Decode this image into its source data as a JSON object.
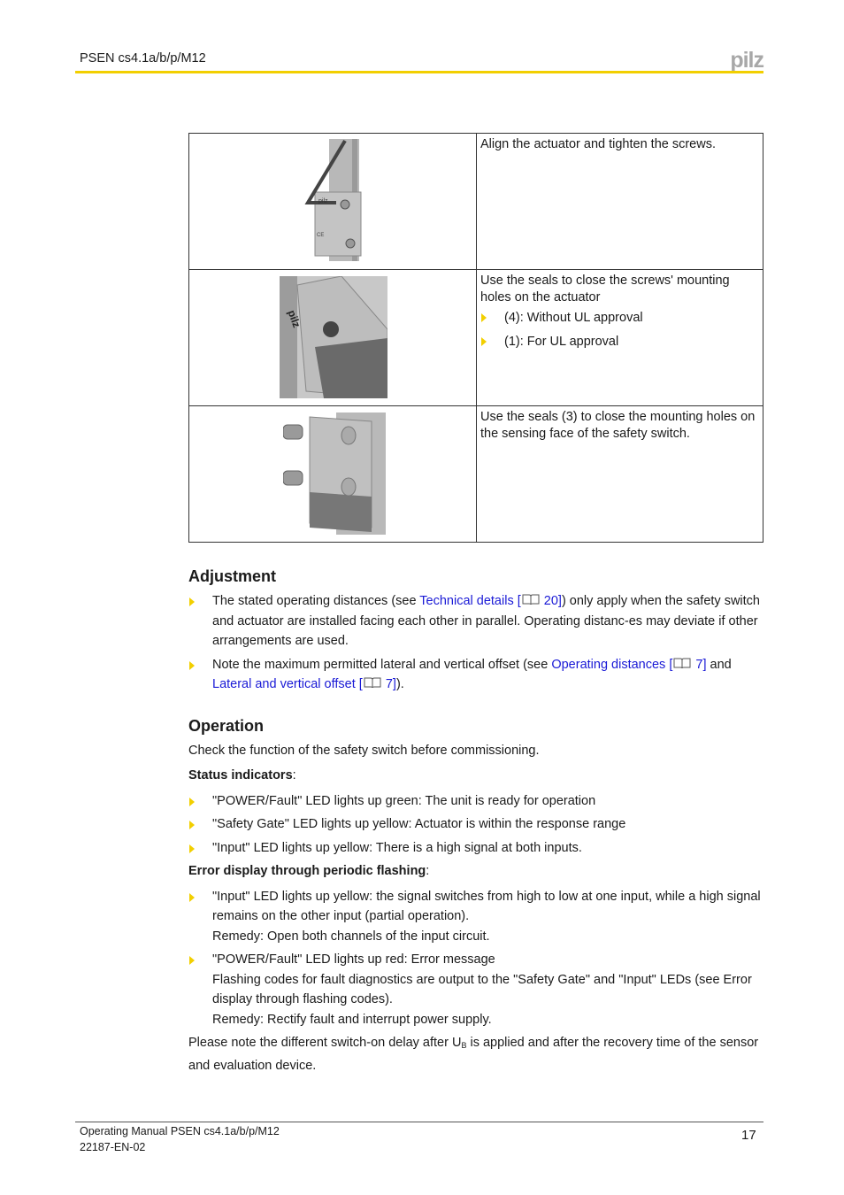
{
  "header": {
    "title": "PSEN cs4.1a/b/p/M12",
    "logo": "pilz",
    "accent_color": "#f2cf00"
  },
  "steps_table": {
    "rows": [
      {
        "image": "actuator-with-hex-key-illustration",
        "text": "Align the actuator and tighten the screws.",
        "bullets": []
      },
      {
        "image": "actuator-seals-illustration",
        "text": "Use the seals to close the screws' mounting holes on the actuator",
        "bullets": [
          "(4): Without UL approval",
          "(1): For UL approval"
        ]
      },
      {
        "image": "sensing-face-seals-illustration",
        "text": "Use the seals (3) to close the mounting holes on the sensing face of the safety switch.",
        "bullets": []
      }
    ]
  },
  "adjustment": {
    "heading": "Adjustment",
    "item1": {
      "pre": "The stated operating distances (see ",
      "link": "Technical details [",
      "link_end": " 20]",
      "post": ") only apply when the safety switch and actuator are installed facing each other in parallel. Operating distanc-es may deviate if other arrangements are used."
    },
    "item2": {
      "pre": "Note the maximum permitted lateral and vertical offset (see ",
      "link1": "Operating distances [",
      "link1_end": " 7]",
      "mid": " and ",
      "link2": "Lateral and vertical offset [",
      "link2_end": " 7]",
      "post": ")."
    }
  },
  "operation": {
    "heading": "Operation",
    "intro": "Check the function of the safety switch before commissioning.",
    "status_label": "Status indicators",
    "status_items": [
      "\"POWER/Fault\" LED lights up green: The unit is ready for operation",
      "\"Safety Gate\" LED lights up yellow: Actuator is within the response range",
      "\"Input\" LED lights up yellow: There is a high signal at both inputs."
    ],
    "error_label": "Error display through periodic flashing",
    "error_items": [
      {
        "line1": "\"Input\" LED lights up yellow: the signal switches from high to low at one input, while a high signal remains on the other input (partial operation).",
        "line2": "Remedy: Open both channels of the input circuit."
      },
      {
        "line1": "\"POWER/Fault\" LED lights up red: Error message",
        "line2": "Flashing codes for fault diagnostics are output to the \"Safety Gate\" and \"Input\" LEDs (see Error display through flashing codes).",
        "line3": "Remedy: Rectify fault and interrupt power supply."
      }
    ],
    "note_pre": "Please note the different switch-on delay after U",
    "note_sub": "B",
    "note_post": " is applied and after the recovery time of the sensor and evaluation device."
  },
  "footer": {
    "line1": "Operating Manual PSEN cs4.1a/b/p/M12",
    "line2": "22187-EN-02",
    "page": "17"
  }
}
